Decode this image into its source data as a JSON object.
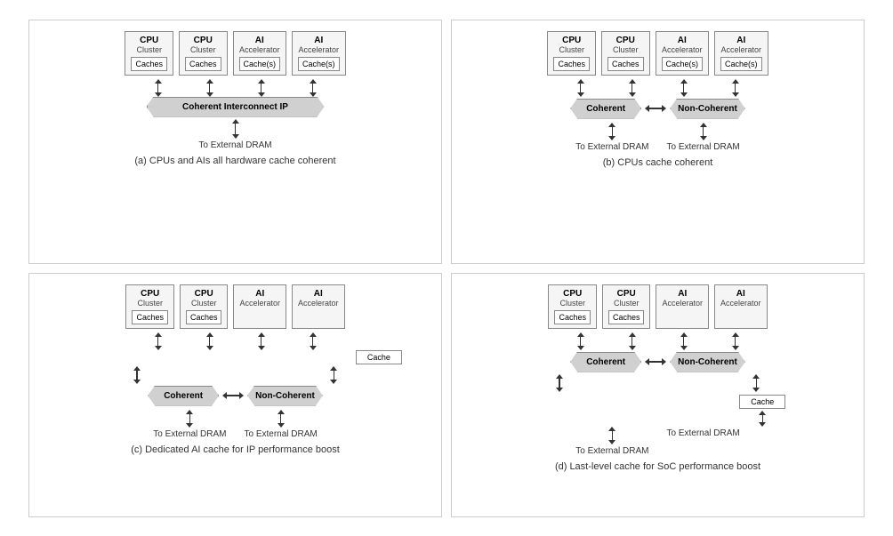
{
  "diagrams": [
    {
      "id": "a",
      "caption": "(a) CPUs and AIs all hardware cache coherent",
      "clusters": [
        {
          "title": "CPU",
          "subtitle": "Cluster",
          "cache": "Caches"
        },
        {
          "title": "CPU",
          "subtitle": "Cluster",
          "cache": "Caches"
        },
        {
          "title": "AI",
          "subtitle": "Accelerator",
          "cache": "Cache(s)"
        },
        {
          "title": "AI",
          "subtitle": "Accelerator",
          "cache": "Cache(s)"
        }
      ],
      "interconnect": "Coherent Interconnect IP",
      "interconnect_type": "single",
      "dram_labels": [
        "To External DRAM"
      ]
    },
    {
      "id": "b",
      "caption": "(b) CPUs cache coherent",
      "clusters": [
        {
          "title": "CPU",
          "subtitle": "Cluster",
          "cache": "Caches"
        },
        {
          "title": "CPU",
          "subtitle": "Cluster",
          "cache": "Caches"
        },
        {
          "title": "AI",
          "subtitle": "Accelerator",
          "cache": "Cache(s)"
        },
        {
          "title": "AI",
          "subtitle": "Accelerator",
          "cache": "Cache(s)"
        }
      ],
      "interconnect": "Coherent",
      "interconnect2": "Non-Coherent",
      "interconnect_type": "dual",
      "dram_labels": [
        "To External DRAM",
        "To External DRAM"
      ]
    },
    {
      "id": "c",
      "caption": "(c) Dedicated AI cache for IP performance boost",
      "clusters": [
        {
          "title": "CPU",
          "subtitle": "Cluster",
          "cache": "Caches"
        },
        {
          "title": "CPU",
          "subtitle": "Cluster",
          "cache": "Caches"
        },
        {
          "title": "AI",
          "subtitle": "Accelerator",
          "cache": null
        },
        {
          "title": "AI",
          "subtitle": "Accelerator",
          "cache": null
        }
      ],
      "ai_cache": "Cache",
      "interconnect": "Coherent",
      "interconnect2": "Non-Coherent",
      "interconnect_type": "dual_with_ai_cache",
      "dram_labels": [
        "To External DRAM",
        "To External DRAM"
      ]
    },
    {
      "id": "d",
      "caption": "(d) Last-level cache for SoC performance boost",
      "clusters": [
        {
          "title": "CPU",
          "subtitle": "Cluster",
          "cache": "Caches"
        },
        {
          "title": "CPU",
          "subtitle": "Cluster",
          "cache": "Caches"
        },
        {
          "title": "AI",
          "subtitle": "Accelerator",
          "cache": null
        },
        {
          "title": "AI",
          "subtitle": "Accelerator",
          "cache": null
        }
      ],
      "llc": "Cache",
      "interconnect": "Coherent",
      "interconnect2": "Non-Coherent",
      "interconnect_type": "dual_with_llc",
      "dram_labels": [
        "To External DRAM",
        "To External DRAM"
      ]
    }
  ]
}
